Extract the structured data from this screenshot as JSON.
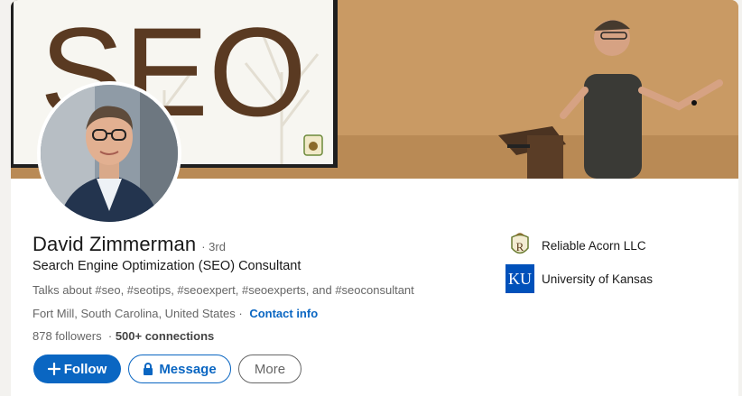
{
  "banner": {
    "sign_text": "SEO"
  },
  "profile": {
    "name": "David Zimmerman",
    "degree": "· 3rd",
    "headline": "Search Engine Optimization (SEO) Consultant",
    "topics": "Talks about #seo, #seotips, #seoexpert, #seoexperts, and #seoconsultant",
    "location": "Fort Mill, South Carolina, United States",
    "location_separator": "·",
    "contact_label": "Contact info",
    "followers": "878 followers",
    "network_separator": "·",
    "connections": "500+ connections"
  },
  "actions": {
    "follow_label": "Follow",
    "message_label": "Message",
    "more_label": "More"
  },
  "organizations": [
    {
      "name": "Reliable Acorn LLC",
      "logo_text": "R",
      "icon": "acorn-shield-logo"
    },
    {
      "name": "University of Kansas",
      "logo_text": "KU",
      "icon": "ku-logo"
    }
  ],
  "colors": {
    "primary": "#0a66c2",
    "text": "#191919",
    "muted": "#666666",
    "ku_blue": "#0051ba"
  }
}
